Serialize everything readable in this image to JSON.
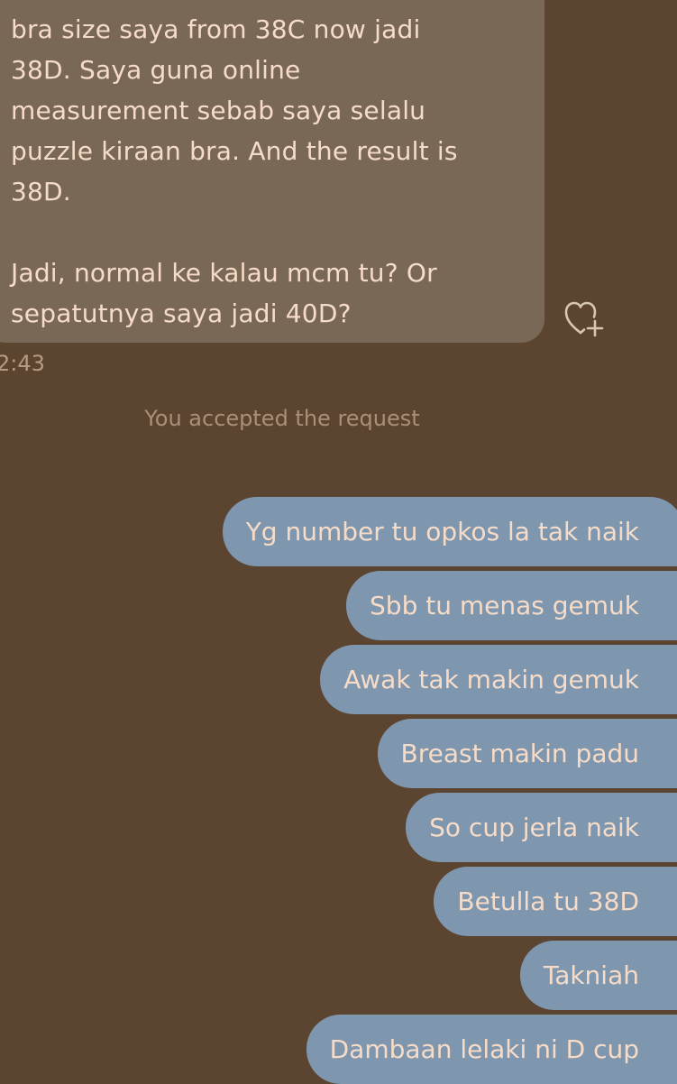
{
  "received_message": {
    "lines": [
      "bra size saya from 38C now jadi",
      "38D.  Saya guna online",
      "measurement sebab saya selalu",
      "puzzle kiraan bra. And the result is",
      "38D.",
      "",
      "Jadi, normal ke kalau mcm tu? Or",
      "sepatutnya saya jadi 40D?"
    ],
    "time": "2:43"
  },
  "system_message": "You accepted the request",
  "sent_messages": [
    "Yg number tu opkos la tak naik",
    "Sbb tu menas gemuk",
    "Awak tak makin gemuk",
    "Breast makin padu",
    "So cup jerla naik",
    "Betulla tu 38D",
    "Takniah",
    "Dambaan lelaki ni D cup"
  ],
  "icons": {
    "react": "heart-plus-icon"
  },
  "colors": {
    "background": "#5b4530",
    "received_bubble": "#7a6856",
    "sent_bubble": "#7e96ae",
    "text": "#f6dcc8"
  }
}
